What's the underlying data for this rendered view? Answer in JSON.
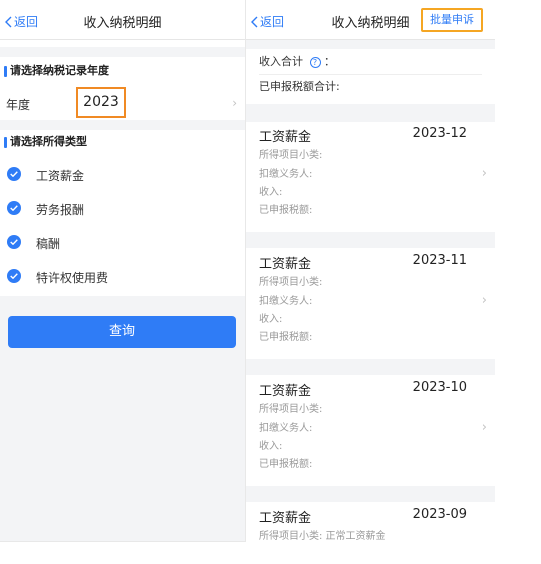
{
  "left": {
    "back_label": "返回",
    "title": "收入纳税明细",
    "section_year": "请选择纳税记录年度",
    "year_label": "年度",
    "year_value": "2023",
    "chevron": "›",
    "section_type": "请选择所得类型",
    "types": [
      "工资薪金",
      "劳务报酬",
      "稿酬",
      "特许权使用费"
    ],
    "query_label": "查询"
  },
  "right": {
    "back_label": "返回",
    "title": "收入纳税明细",
    "batch_label": "批量申诉",
    "income_total_label": "收入合计",
    "info_glyph": "?",
    "colon": "：",
    "declared_total_label": "已申报税额合计:",
    "chevron": "›",
    "field_labels": [
      "所得项目小类:",
      "扣缴义务人:",
      "收入:",
      "已申报税额:"
    ],
    "records": [
      {
        "name": "工资薪金",
        "period": "2023-12"
      },
      {
        "name": "工资薪金",
        "period": "2023-11"
      },
      {
        "name": "工资薪金",
        "period": "2023-10"
      },
      {
        "name": "工资薪金",
        "period": "2023-09",
        "subtype": "所得项目小类:  正常工资薪金"
      }
    ]
  },
  "colors": {
    "accent": "#2f7cf6",
    "highlight_orange": "#f08a24",
    "highlight_amber": "#f5a623",
    "gap": "#f3f4f6"
  }
}
